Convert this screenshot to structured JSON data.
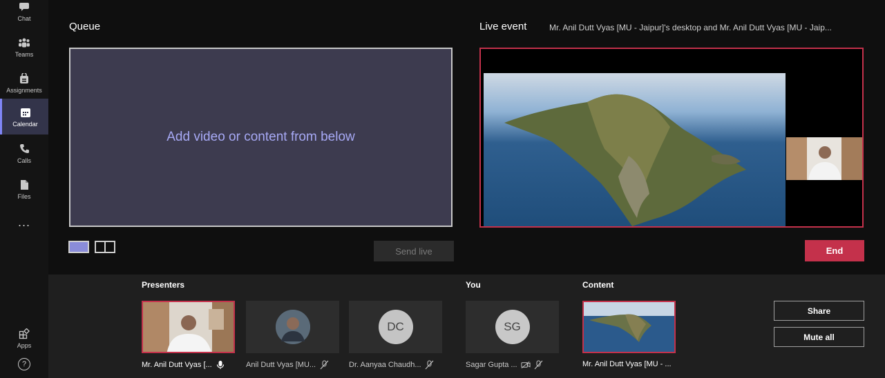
{
  "rail": {
    "items": [
      {
        "label": "Chat",
        "icon": "chat-icon"
      },
      {
        "label": "Teams",
        "icon": "teams-icon"
      },
      {
        "label": "Assignments",
        "icon": "assignments-icon"
      },
      {
        "label": "Calendar",
        "icon": "calendar-icon",
        "active": true
      },
      {
        "label": "Calls",
        "icon": "phone-icon"
      },
      {
        "label": "Files",
        "icon": "file-icon"
      }
    ],
    "more": "...",
    "apps_label": "Apps",
    "help_label": "?"
  },
  "queue": {
    "title": "Queue",
    "placeholder": "Add video or content from below",
    "send_live": "Send live"
  },
  "live": {
    "title": "Live event",
    "subtitle": "Mr. Anil Dutt Vyas [MU - Jaipur]'s desktop and Mr. Anil Dutt Vyas [MU - Jaip...",
    "end": "End"
  },
  "tray": {
    "presenters_label": "Presenters",
    "you_label": "You",
    "content_label": "Content",
    "presenters": [
      {
        "name": "Mr. Anil Dutt Vyas [..."
      },
      {
        "name": "Anil Dutt Vyas [MU..."
      },
      {
        "name": "Dr. Aanyaa Chaudh...",
        "initials": "DC"
      }
    ],
    "you": {
      "name": "Sagar Gupta ...",
      "initials": "SG"
    },
    "content": {
      "name": "Mr. Anil Dutt Vyas [MU - ..."
    },
    "share": "Share",
    "mute_all": "Mute all"
  },
  "colors": {
    "accent": "#c4314b",
    "brand": "#7f85f5"
  }
}
